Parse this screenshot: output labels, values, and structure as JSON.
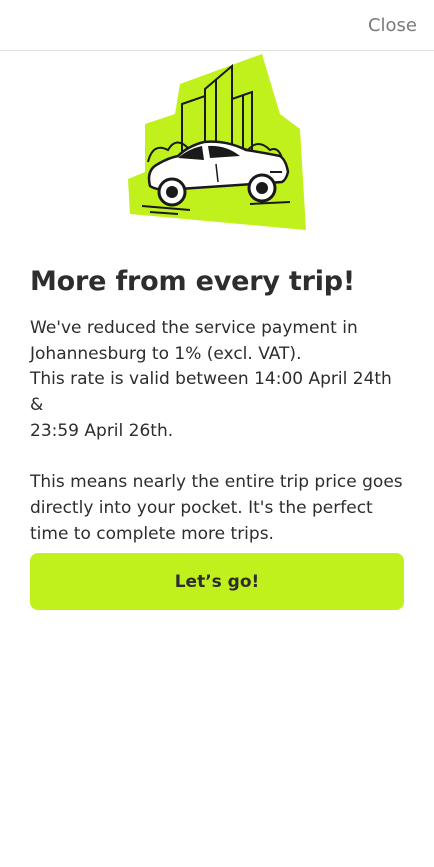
{
  "header": {
    "close_label": "Close"
  },
  "title": "More from every trip!",
  "body": {
    "line1": "We've reduced the service payment in",
    "line2": "Johannesburg to 1% (excl. VAT).",
    "line3": "This rate is valid between 14:00 April 24th &",
    "line4": "23:59 April 26th.",
    "para2_line1": "This means nearly the entire trip price goes",
    "para2_line2": "directly into your pocket. It's the perfect",
    "para2_line3": "time to complete more trips."
  },
  "cta": {
    "label": "Let’s go!"
  },
  "colors": {
    "accent": "#c1f11d",
    "text": "#2d2d2d",
    "muted": "#7a7a7a"
  },
  "illustration": {
    "icon": "car-city-illustration"
  }
}
